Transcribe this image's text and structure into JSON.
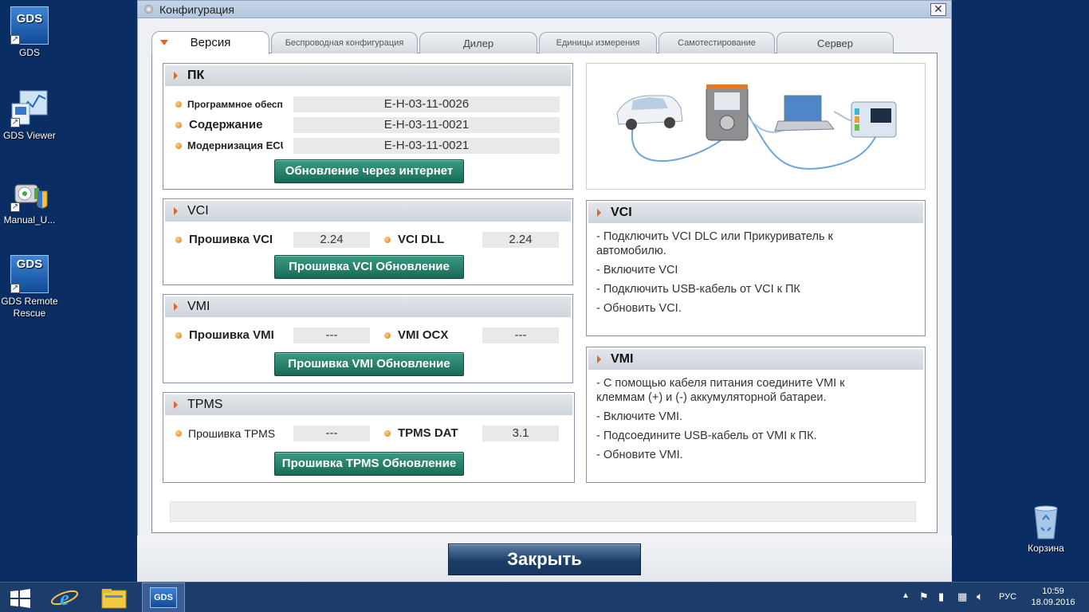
{
  "desktop": {
    "icons": [
      {
        "label": "GDS",
        "badge": "GDS"
      },
      {
        "label": "GDS Viewer"
      },
      {
        "label": "Manual_U..."
      },
      {
        "label": "GDS Remote Rescue",
        "badge": "GDS"
      },
      {
        "label": "Корзина"
      }
    ]
  },
  "dialog": {
    "title": "Конфигурация",
    "close_glyph": "✕",
    "tabs": [
      {
        "label": "Версия"
      },
      {
        "label": "Беспроводная конфигурация"
      },
      {
        "label": "Дилер"
      },
      {
        "label": "Единицы измерения"
      },
      {
        "label": "Самотестирование"
      },
      {
        "label": "Сервер"
      }
    ],
    "pc": {
      "title": "ПК",
      "rows": [
        {
          "label": "Программное обеспечение",
          "value": "E-H-03-11-0026"
        },
        {
          "label": "Содержание",
          "value": "E-H-03-11-0021"
        },
        {
          "label": "Модернизация ECU",
          "value": "E-H-03-11-0021"
        }
      ],
      "button": "Обновление через интернет"
    },
    "vci": {
      "title": "VCI",
      "fw_label": "Прошивка VCI",
      "fw_value": "2.24",
      "dll_label": "VCI DLL",
      "dll_value": "2.24",
      "button": "Прошивка VCI Обновление"
    },
    "vmi": {
      "title": "VMI",
      "fw_label": "Прошивка VMI",
      "fw_value": "---",
      "ocx_label": "VMI OCX",
      "ocx_value": "---",
      "button": "Прошивка VMI Обновление"
    },
    "tpms": {
      "title": "TPMS",
      "fw_label": "Прошивка TPMS",
      "fw_value": "---",
      "dat_label": "TPMS DAT",
      "dat_value": "3.1",
      "button": "Прошивка TPMS Обновление"
    },
    "vci_info": {
      "title": "VCI",
      "lines": [
        "- Подключить VCI DLC или Прикуриватель к автомобилю.",
        "- Включите VCI",
        "- Подключить USB-кабель от VCI к ПК",
        "- Обновить VCI."
      ]
    },
    "vmi_info": {
      "title": "VMI",
      "lines": [
        "- С помощью кабеля питания соедините VMI к клеммам (+) и (-) аккумуляторной батареи.",
        "- Включите VMI.",
        "- Подсоедините USB-кабель от VMI к ПК.",
        "- Обновите VMI."
      ]
    },
    "close_button": "Закрыть"
  },
  "taskbar": {
    "gds_label": "GDS",
    "language": "РУС",
    "time": "10:59",
    "date": "18.09.2016",
    "ie_glyph": "e"
  },
  "colors": {
    "desktop_bg": "#0a2d63",
    "accent_orange": "#e0652a",
    "button_green": "#1a6b57",
    "close_blue": "#1b3e6a"
  }
}
